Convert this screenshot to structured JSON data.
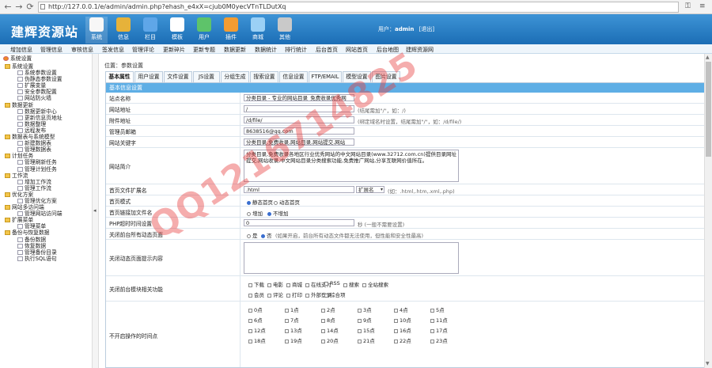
{
  "browser": {
    "url": "http://127.0.0.1/e/admin/admin.php?ehash_e4xX=cjub0M0yecVTnTLDutXq",
    "back": "←",
    "forward": "→",
    "reload": "⟳"
  },
  "header": {
    "logo": "建辉资源站",
    "menu": [
      "系统",
      "信息",
      "栏目",
      "模板",
      "用户",
      "插件",
      "商城",
      "其他"
    ],
    "user_label": "用户：",
    "user_name": "admin",
    "logout": "[退出]"
  },
  "subnav": [
    "增加信息",
    "管理信息",
    "审核信息",
    "签发信息",
    "管理评论",
    "更新碎片",
    "更新专题",
    "数据更新",
    "数据统计",
    "排行统计",
    "后台首页",
    "网站首页",
    "后台地图",
    "建辉资源网"
  ],
  "sidebar": {
    "root": "系统设置",
    "items": [
      {
        "t": "系统设置",
        "lvl": 0,
        "fold": true
      },
      {
        "t": "系统参数设置",
        "lvl": 1
      },
      {
        "t": "伪静态参数设置",
        "lvl": 1
      },
      {
        "t": "扩展变量",
        "lvl": 1
      },
      {
        "t": "安全参数配置",
        "lvl": 1
      },
      {
        "t": "网站防火墙",
        "lvl": 1
      },
      {
        "t": "数据更新",
        "lvl": 0,
        "fold": true
      },
      {
        "t": "数据更新中心",
        "lvl": 1
      },
      {
        "t": "更新信息页地址",
        "lvl": 1
      },
      {
        "t": "数据整理",
        "lvl": 1
      },
      {
        "t": "远程发布",
        "lvl": 1
      },
      {
        "t": "数据表与系统模型",
        "lvl": 0,
        "fold": true
      },
      {
        "t": "新建数据表",
        "lvl": 1
      },
      {
        "t": "管理数据表",
        "lvl": 1
      },
      {
        "t": "计划任务",
        "lvl": 0,
        "fold": true
      },
      {
        "t": "管理刷新任务",
        "lvl": 1
      },
      {
        "t": "管理计划任务",
        "lvl": 1
      },
      {
        "t": "工作流",
        "lvl": 0,
        "fold": true
      },
      {
        "t": "增加工作流",
        "lvl": 1
      },
      {
        "t": "管理工作流",
        "lvl": 1
      },
      {
        "t": "优化方案",
        "lvl": 0,
        "fold": true
      },
      {
        "t": "管理优化方案",
        "lvl": 1
      },
      {
        "t": "网站多访问端",
        "lvl": 0,
        "fold": true
      },
      {
        "t": "管理网站访问端",
        "lvl": 1
      },
      {
        "t": "扩展菜单",
        "lvl": 0,
        "fold": true
      },
      {
        "t": "管理菜单",
        "lvl": 1
      },
      {
        "t": "备份与恢复数据",
        "lvl": 0,
        "fold": true
      },
      {
        "t": "备份数据",
        "lvl": 1
      },
      {
        "t": "恢复数据",
        "lvl": 1
      },
      {
        "t": "管理备份目录",
        "lvl": 1
      },
      {
        "t": "执行SQL语句",
        "lvl": 1
      }
    ]
  },
  "main": {
    "crumb": "位置：参数设置",
    "tabs": [
      "基本属性",
      "用户设置",
      "文件设置",
      "JS设置",
      "分组生成",
      "搜索设置",
      "信息设置",
      "FTP/EMAIL",
      "模型设置",
      "图片设置"
    ],
    "section": "基本信息设置",
    "fields": {
      "sitename_label": "站点名称",
      "sitename": "分类目录 - 专业的网站目录_免费收录优秀网",
      "siteurl_label": "网站地址",
      "siteurl": "/",
      "siteurl_hint": "(结尾需加\"/\"，如：/)",
      "fileurl_label": "附件地址",
      "fileurl": "/d/file/",
      "fileurl_hint": "(绑定域名时设置，结尾需加\"/\"，如：/d/file/)",
      "email_label": "管理员邮箱",
      "email": "8638516@qq.com",
      "keywords_label": "网站关键字",
      "keywords": "分类目录,免费收录,网站目录,网站提交,网站",
      "intro_label": "网站简介",
      "intro": "分类目录,免费收录各地区行业优秀网站的中文网站目录(www.32712.com.cn)提供目录网址提交,网站收录,中文网站目录分类搜索功能,免费推广网站,分享互联网价值所在。",
      "ext_label": "首页文件扩展名",
      "ext": ".html",
      "ext_sel": "扩展名",
      "ext_hint": "(如：.html,.htm,.xml,.php)",
      "mode_label": "首页模式",
      "mode_opts": [
        "静态首页",
        "动态首页"
      ],
      "link_label": "首页链接加文件名",
      "link_opts": [
        "增加",
        "不增加"
      ],
      "php_label": "PHP超时时间设置",
      "php_val": "0",
      "php_hint": "秒 (一般不需要设置)",
      "close_label": "关闭前台所有动态页面",
      "close_opts": [
        "是",
        "否"
      ],
      "close_hint": "(如果开启，前台所有动态文件都无法使用，但性能和安全性最高)",
      "closetext_label": "关闭动态页面提示内容",
      "closemod_label": "关闭前台模块相关功能",
      "closemod_row1": [
        "下载",
        "电影",
        "商城",
        "在线支付",
        "RSS",
        "搜索",
        "全站搜索"
      ],
      "closemod_row2": [
        "会员",
        "评论",
        "打印",
        "外部登录",
        "综合项"
      ],
      "closetime_label": "不开启操作的时间点",
      "hours_row1": [
        "0点",
        "1点",
        "2点",
        "3点",
        "4点",
        "5点"
      ],
      "hours_row2": [
        "6点",
        "7点",
        "8点",
        "9点",
        "10点",
        "11点"
      ],
      "hours_row3": [
        "12点",
        "13点",
        "14点",
        "15点",
        "16点",
        "17点"
      ],
      "hours_row4": [
        "18点",
        "19点",
        "20点",
        "21点",
        "22点",
        "23点"
      ]
    }
  },
  "watermark": "QQ1216714825"
}
